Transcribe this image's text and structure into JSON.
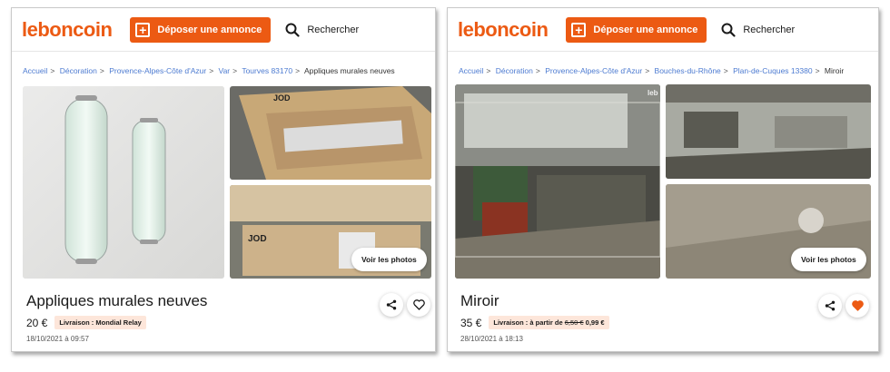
{
  "brand": {
    "logo": "leboncoin",
    "accent": "#ec5a13"
  },
  "header": {
    "deposit_label": "Déposer une annonce",
    "search_label": "Rechercher"
  },
  "listings": [
    {
      "breadcrumb": [
        "Accueil",
        "Décoration",
        "Provence-Alpes-Côte d'Azur",
        "Var",
        "Tourves 83170"
      ],
      "breadcrumb_current": "Appliques murales neuves",
      "title": "Appliques murales neuves",
      "price": "20 €",
      "delivery_label": "Livraison : Mondial Relay",
      "date": "18/10/2021 à 09:57",
      "see_photos": "Voir les photos",
      "photo_text_1": "JOD",
      "photo_text_2": "JOD",
      "favorited": false
    },
    {
      "breadcrumb": [
        "Accueil",
        "Décoration",
        "Provence-Alpes-Côte d'Azur",
        "Bouches-du-Rhône",
        "Plan-de-Cuques 13380"
      ],
      "breadcrumb_current": "Miroir",
      "title": "Miroir",
      "price": "35 €",
      "delivery_prefix": "Livraison : à partir de ",
      "delivery_old": "6,50 €",
      "delivery_new": " 0,99 €",
      "date": "28/10/2021 à 18:13",
      "see_photos": "Voir les photos",
      "watermark": "leb",
      "favorited": true
    }
  ]
}
